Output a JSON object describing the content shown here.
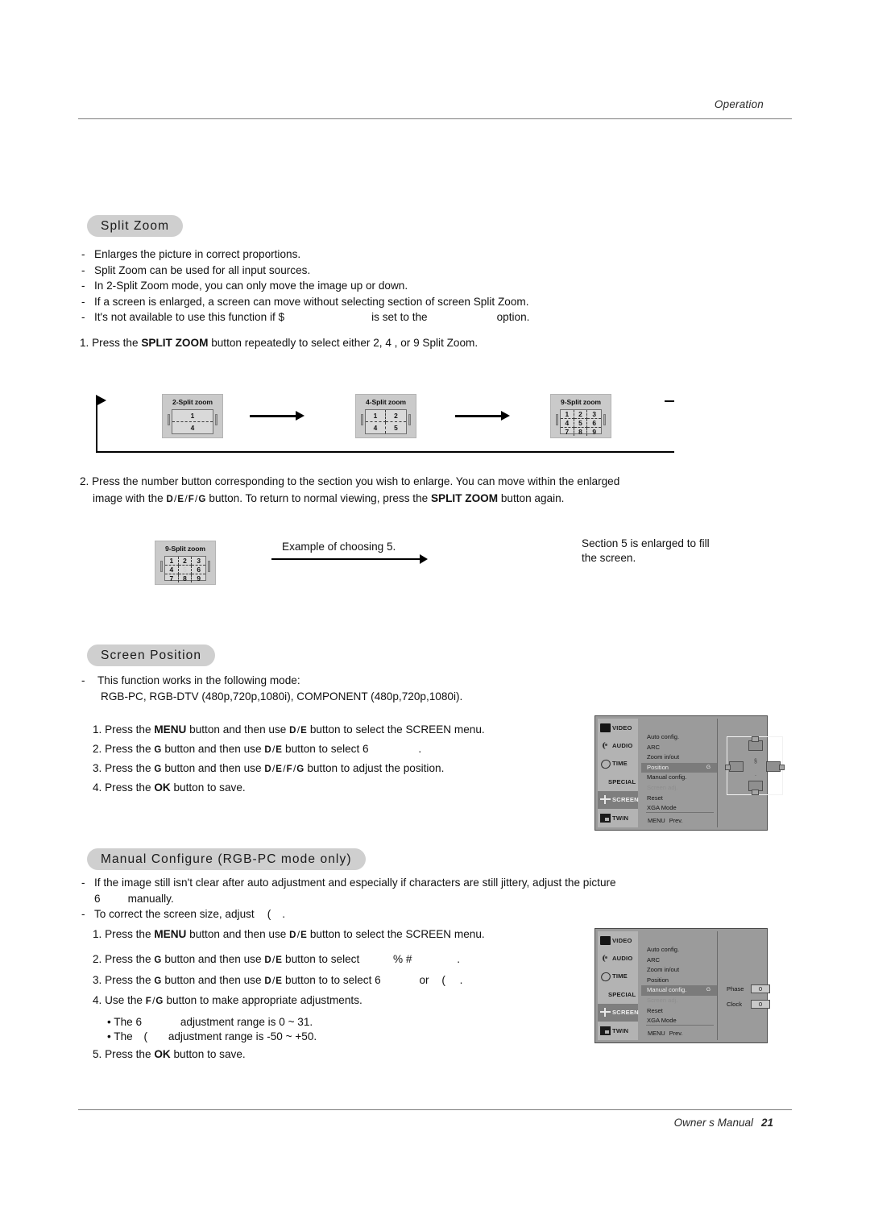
{
  "header": {
    "section": "Operation"
  },
  "footer": {
    "manual": "Owner s Manual",
    "page": "21"
  },
  "split_zoom": {
    "title": "Split Zoom",
    "bullets": [
      "Enlarges the picture in correct proportions.",
      "Split Zoom can be used for all input sources.",
      "In 2-Split Zoom mode, you can only move the image up or down.",
      "If a screen is enlarged, a screen can move without selecting section of screen Split Zoom."
    ],
    "bullet5_a": "It's not available to use this function if $",
    "bullet5_b": "is set to the",
    "bullet5_c": "option.",
    "step1_a": "1. Press the",
    "step1_key": "SPLIT ZOOM",
    "step1_b": "button repeatedly to select either 2, 4 , or 9 Split Zoom.",
    "step2_line1": "2. Press the number button corresponding to the section you wish to enlarge. You can move within the enlarged",
    "step2_line2_a": "image with the",
    "step2_line2_b": "button. To return to normal viewing, press the",
    "step2_line2_key": "SPLIT ZOOM",
    "step2_line2_c": "button again.",
    "diagram": {
      "tiles": [
        {
          "caption": "2-Split zoom",
          "cols": 1,
          "rows": 2,
          "cells": [
            "1",
            "4"
          ]
        },
        {
          "caption": "4-Split zoom",
          "cols": 2,
          "rows": 2,
          "cells": [
            "1",
            "2",
            "4",
            "5"
          ]
        },
        {
          "caption": "9-Split zoom",
          "cols": 3,
          "rows": 3,
          "cells": [
            "1",
            "2",
            "3",
            "4",
            "5",
            "6",
            "7",
            "8",
            "9"
          ]
        }
      ]
    },
    "example": {
      "caption": "9-Split zoom",
      "cells": [
        "1",
        "2",
        "3",
        "4",
        "5",
        "6",
        "7",
        "8",
        "9"
      ],
      "selected_index": 4,
      "arrow_label": "Example of choosing 5.",
      "result_line1": "Section 5 is enlarged to fill",
      "result_line2": "the screen."
    }
  },
  "screen_position": {
    "title": "Screen Position",
    "note_line1": "This function works in the following mode:",
    "note_line2": "RGB-PC, RGB-DTV (480p,720p,1080i), COMPONENT (480p,720p,1080i).",
    "steps": {
      "s1_a": "1. Press the",
      "s1_key": "MENU",
      "s1_b": "button and then use",
      "s1_c": "button to select the SCREEN menu.",
      "s2_a": "2. Press the",
      "s2_b": "button and then use",
      "s2_c": "button to select",
      "s2_glyph": "6",
      "s2_d": ".",
      "s3_a": "3. Press the",
      "s3_b": "button and then use",
      "s3_c": "button to adjust the position.",
      "s4_a": "4. Press the",
      "s4_key": "OK",
      "s4_b": "button to save."
    }
  },
  "manual_configure": {
    "title": "Manual Configure (RGB-PC mode only)",
    "note1_line1": "If the image still isn't clear after auto adjustment and especially if characters are still jittery, adjust the picture",
    "note1_line2_glyph": "6",
    "note1_line2_text": "manually.",
    "note2_a": "To correct the screen size, adjust",
    "note2_glyph": "(",
    "note2_b": ".",
    "steps": {
      "s1_a": "1. Press the",
      "s1_key": "MENU",
      "s1_b": "button and then use",
      "s1_c": "button to select the SCREEN menu.",
      "s2_a": "2. Press the",
      "s2_b": "button and then use",
      "s2_c": "button to select",
      "s2_glyph": "% #",
      "s2_d": ".",
      "s3_a": "3. Press the",
      "s3_b": "button and then use",
      "s3_c": "button to to select",
      "s3_glyph1": "6",
      "s3_or": "or",
      "s3_glyph2": "(",
      "s3_d": ".",
      "s4_a": "4. Use the",
      "s4_b": "button to make appropriate adjustments.",
      "b1_a": "• The",
      "b1_glyph": "6",
      "b1_b": "adjustment range is 0 ~ 31.",
      "b2_a": "• The",
      "b2_glyph": "(",
      "b2_b": "adjustment range is -50 ~ +50.",
      "s5_a": "5. Press the",
      "s5_key": "OK",
      "s5_b": "button to save."
    }
  },
  "keys": {
    "down": "D",
    "up": "E",
    "left": "F",
    "right": "G",
    "slash": "/"
  },
  "osd_position": {
    "sidebar": [
      {
        "label": "VIDEO",
        "icon": "video-icon",
        "active": false
      },
      {
        "label": "AUDIO",
        "icon": "audio-icon",
        "active": false
      },
      {
        "label": "TIME",
        "icon": "time-icon",
        "active": false
      },
      {
        "label": "SPECIAL",
        "icon": "special-icon",
        "active": false
      },
      {
        "label": "SCREEN",
        "icon": "screen-icon",
        "active": true
      },
      {
        "label": "TWIN",
        "icon": "twin-icon",
        "active": false
      }
    ],
    "menu": [
      {
        "label": "Auto config.",
        "state": "normal"
      },
      {
        "label": "ARC",
        "state": "normal"
      },
      {
        "label": "Zoom in/out",
        "state": "normal"
      },
      {
        "label": "Position",
        "state": "active",
        "mark": "G"
      },
      {
        "label": "Manual config.",
        "state": "normal"
      },
      {
        "label": "Screen adj.",
        "state": "disabled"
      },
      {
        "label": "Reset",
        "state": "normal"
      },
      {
        "label": "XGA Mode",
        "state": "normal"
      }
    ],
    "prev_key": "MENU",
    "prev_label": "Prev.",
    "position_marks": {
      "top": "§",
      "bottom": "."
    }
  },
  "osd_manual": {
    "sidebar": [
      {
        "label": "VIDEO",
        "icon": "video-icon",
        "active": false
      },
      {
        "label": "AUDIO",
        "icon": "audio-icon",
        "active": false
      },
      {
        "label": "TIME",
        "icon": "time-icon",
        "active": false
      },
      {
        "label": "SPECIAL",
        "icon": "special-icon",
        "active": false
      },
      {
        "label": "SCREEN",
        "icon": "screen-icon",
        "active": true
      },
      {
        "label": "TWIN",
        "icon": "twin-icon",
        "active": false
      }
    ],
    "menu": [
      {
        "label": "Auto config.",
        "state": "normal"
      },
      {
        "label": "ARC",
        "state": "normal"
      },
      {
        "label": "Zoom in/out",
        "state": "normal"
      },
      {
        "label": "Position",
        "state": "normal"
      },
      {
        "label": "Manual config.",
        "state": "active",
        "mark": "G"
      },
      {
        "label": "Screen adj.",
        "state": "disabled"
      },
      {
        "label": "Reset",
        "state": "normal"
      },
      {
        "label": "XGA Mode",
        "state": "normal"
      }
    ],
    "prev_key": "MENU",
    "prev_label": "Prev.",
    "values": [
      {
        "name": "Phase",
        "value": "0"
      },
      {
        "name": "Clock",
        "value": "0"
      }
    ]
  },
  "colors": {
    "pill_bg": "#cfcfcf",
    "osd_bg": "#9b9b9b",
    "osd_sidebar": "#b3b3b3",
    "osd_active": "#7b7b7b",
    "tile_bg": "#cacaca",
    "rule": "#7d7d7d"
  }
}
